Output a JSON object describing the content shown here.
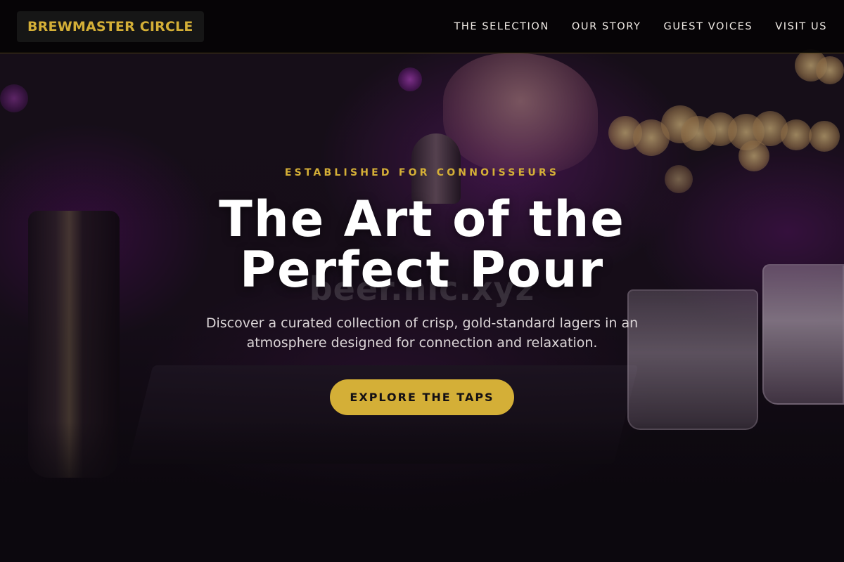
{
  "header": {
    "brand": "BREWMASTER CIRCLE",
    "nav": [
      "THE SELECTION",
      "OUR STORY",
      "GUEST VOICES",
      "VISIT US"
    ]
  },
  "hero": {
    "eyebrow": "ESTABLISHED FOR CONNOISSEURS",
    "headline_line1": "The Art of the",
    "headline_line2": "Perfect Pour",
    "watermark": "beer.nic.xyz",
    "subtitle": "Discover a curated collection of crisp, gold-standard lagers in an atmosphere designed for connection and relaxation.",
    "cta_label": "EXPLORE THE TAPS",
    "background_image": "bartender-pouring-drink-bar-scene"
  },
  "colors": {
    "accent_gold": "#d4af37",
    "header_bg": "#050405",
    "text_light": "#f1ece6"
  }
}
